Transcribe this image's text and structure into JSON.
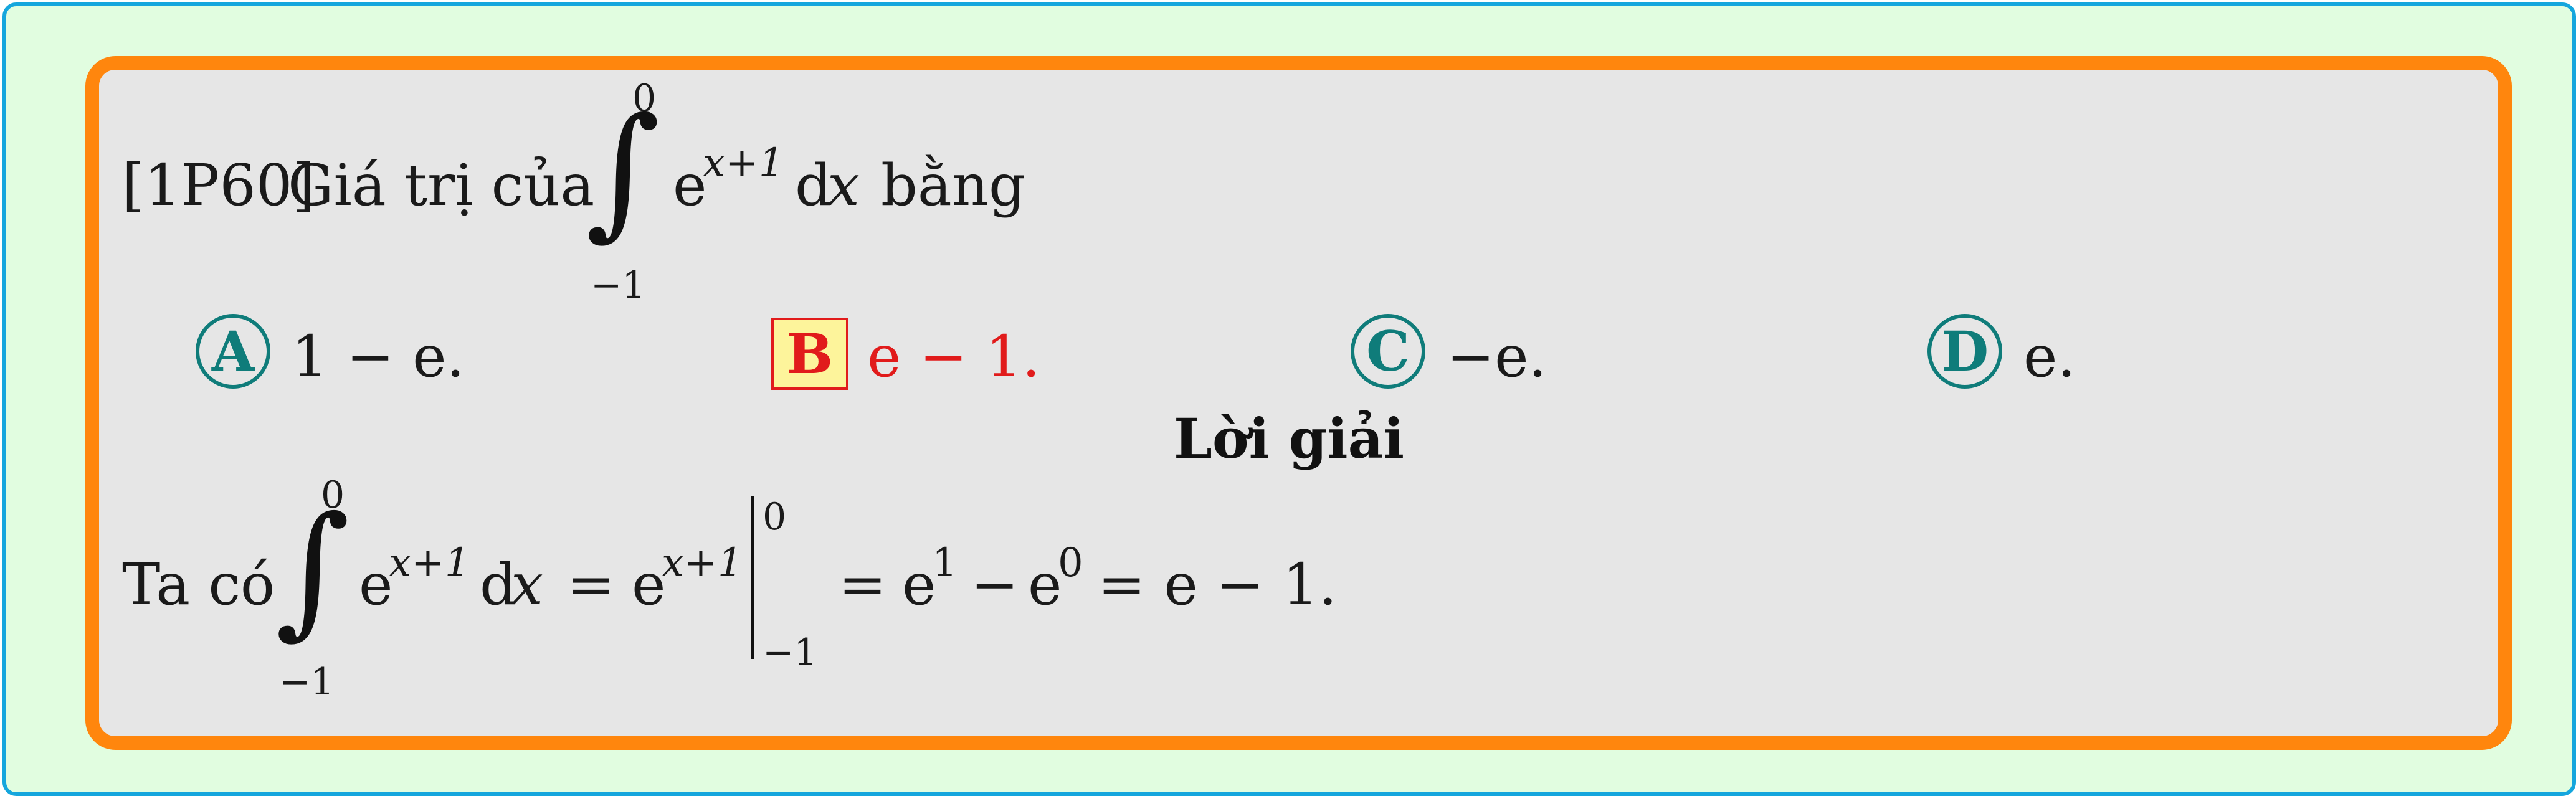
{
  "question": {
    "code": "[1P60]",
    "text_before": "Giá trị của",
    "integral": {
      "upper": "0",
      "lower": "−1",
      "base": "e",
      "exponent": "x+1",
      "differential_d": "d",
      "differential_var": "x"
    },
    "text_after": "bằng"
  },
  "choices": [
    {
      "letter": "A",
      "text": "1 − e.",
      "correct": false
    },
    {
      "letter": "B",
      "text": "e − 1.",
      "correct": true
    },
    {
      "letter": "C",
      "text": "−e.",
      "correct": false
    },
    {
      "letter": "D",
      "text": "e.",
      "correct": false
    }
  ],
  "solution": {
    "heading": "Lời giải",
    "intro": "Ta có",
    "integral": {
      "upper": "0",
      "lower": "−1",
      "base": "e",
      "exponent": "x+1",
      "differential_d": "d",
      "differential_var": "x"
    },
    "equals1": "=",
    "antiderivative": {
      "base": "e",
      "exponent": "x+1"
    },
    "eval": {
      "upper": "0",
      "lower": "−1"
    },
    "rest": {
      "eq": "=",
      "t1": "e",
      "t1_exp": "1",
      "minus": "−",
      "t2": "e",
      "t2_exp": "0",
      "tail": "= e − 1."
    }
  },
  "colors": {
    "outer_bg": "#e1fde0",
    "outer_border": "#15a6dd",
    "card_bg": "#e6e6e6",
    "card_border": "#ff860d",
    "choice_circle": "#0f7c7a",
    "correct": "#e11b1b",
    "correct_box_bg": "#fdf49b"
  }
}
